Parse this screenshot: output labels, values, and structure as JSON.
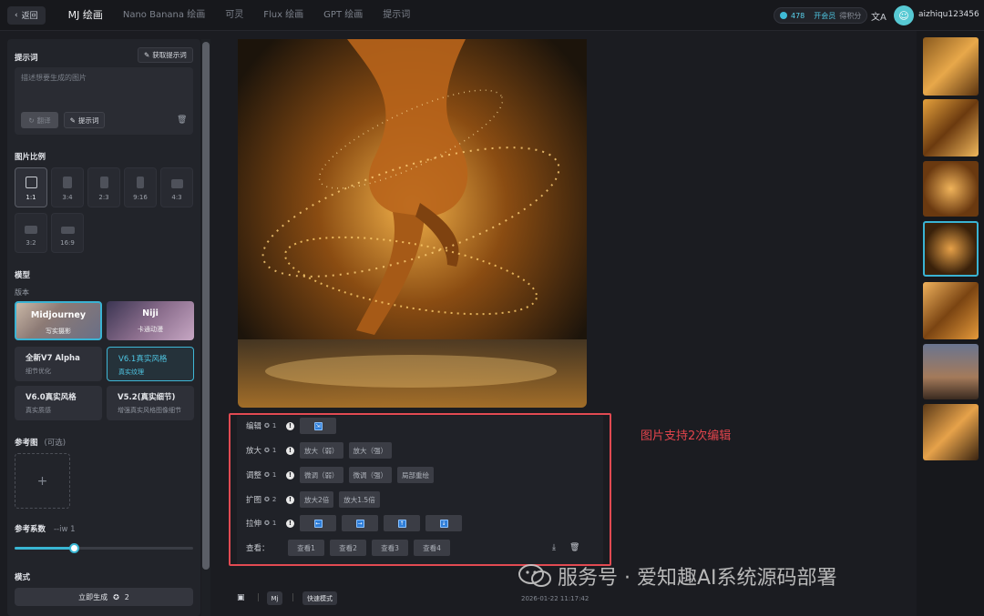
{
  "topbar": {
    "back_label": "返回",
    "tabs": [
      "MJ 绘画",
      "Nano Banana 绘画",
      "可灵",
      "Flux 绘画",
      "GPT 绘画",
      "提示词"
    ],
    "active_tab": "MJ 绘画",
    "points": "478",
    "vip_label": "开会员",
    "earn_label": "得积分",
    "username": "aizhiqu123456"
  },
  "sidebar": {
    "prompt_title": "提示词",
    "get_prompt_label": "获取提示词",
    "prompt_placeholder": "描述想要生成的图片",
    "translate_label": "翻译",
    "prompt_button_label": "提示词",
    "ratio_title": "图片比例",
    "ratios": [
      "1:1",
      "3:4",
      "2:3",
      "9:16",
      "4:3",
      "3:2",
      "16:9"
    ],
    "selected_ratio": "1:1",
    "model_title": "模型",
    "version_label": "版本",
    "model_cards": [
      {
        "title": "Midjourney",
        "subtitle": "写实摄影"
      },
      {
        "title": "Niji",
        "subtitle": "卡通动漫"
      }
    ],
    "version_cards": [
      {
        "title": "全新V7 Alpha",
        "subtitle": "细节优化"
      },
      {
        "title": "V6.1真实风格",
        "subtitle": "真实纹理"
      },
      {
        "title": "V6.0真实风格",
        "subtitle": "真实质感"
      },
      {
        "title": "V5.2(真实细节)",
        "subtitle": "增强真实风格图像细节"
      }
    ],
    "selected_version": "V6.1真实风格",
    "ref_title": "参考图",
    "ref_optional": "(可选)",
    "coef_title": "参考系数",
    "coef_value": "--iw 1",
    "coef_level": 0.33,
    "mode_title": "模式",
    "generate_label": "立即生成",
    "generate_cost": "2"
  },
  "actions": {
    "rows": [
      {
        "label": "编辑",
        "cost": "1",
        "buttons": [
          "icon"
        ]
      },
      {
        "label": "放大",
        "cost": "1",
        "buttons": [
          "放大（弱）",
          "放大（强）"
        ]
      },
      {
        "label": "调整",
        "cost": "1",
        "buttons": [
          "微调（弱）",
          "微调（强）",
          "局部重绘"
        ]
      },
      {
        "label": "扩图",
        "cost": "2",
        "buttons": [
          "放大2倍",
          "放大1.5倍"
        ]
      },
      {
        "label": "拉伸",
        "cost": "1",
        "buttons": [
          "←",
          "→",
          "↑",
          "↓"
        ]
      }
    ],
    "view_label": "查看：",
    "view_buttons": [
      "查看1",
      "查看2",
      "查看3",
      "查看4"
    ]
  },
  "annotation": "图片支持2次编辑",
  "bottom": {
    "mj_badge": "Mj",
    "fast_mode": "快速模式",
    "timestamp": "2026-01-22 11:17:42"
  },
  "watermark": "服务号 · 爱知趣AI系统源码部署",
  "colors": {
    "accent": "#39b6d3",
    "annotation": "#e24a52",
    "bg": "#1b1c21"
  }
}
